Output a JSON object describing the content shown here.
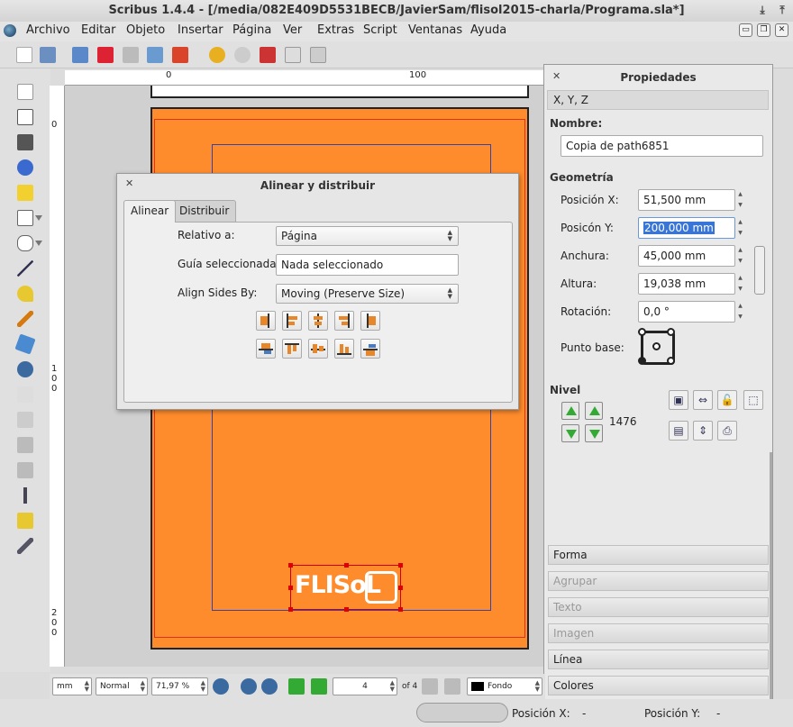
{
  "window": {
    "title": "Scribus 1.4.4 - [/media/082E409D5531BECB/JavierSam/flisol2015-charla/Programa.sla*]"
  },
  "menu": [
    "Archivo",
    "Editar",
    "Objeto",
    "Insertar",
    "Página",
    "Ver",
    "Extras",
    "Script",
    "Ventanas",
    "Ayuda"
  ],
  "ruler": {
    "top_0": "0",
    "top_100": "100",
    "left_0": "0",
    "left_100": [
      "1",
      "0",
      "0"
    ],
    "left_200": [
      "2",
      "0",
      "0"
    ]
  },
  "canvas": {
    "logo_text": "FLISoL"
  },
  "dialog": {
    "title": "Alinear y distribuir",
    "tabs": [
      "Alinear",
      "Distribuir"
    ],
    "relativo_label": "Relativo a:",
    "relativo_value": "Página",
    "guia_label": "Guía seleccionada:",
    "guia_value": "Nada seleccionado",
    "align_label": "Align Sides By:",
    "align_value": "Moving (Preserve Size)"
  },
  "props": {
    "title": "Propiedades",
    "xyz_tab": "X, Y, Z",
    "nombre_label": "Nombre:",
    "nombre_value": "Copia de   path6851",
    "geometria_label": "Geometría",
    "pos_x_label": "Posición X:",
    "pos_x_value": "51,500 mm",
    "pos_y_label": "Posicón Y:",
    "pos_y_value": "200,000 mm",
    "anchura_label": "Anchura:",
    "anchura_value": "45,000 mm",
    "altura_label": "Altura:",
    "altura_value": "19,038 mm",
    "rotacion_label": "Rotación:",
    "rotacion_value": "0,0 °",
    "punto_base_label": "Punto base:",
    "nivel_label": "Nivel",
    "nivel_value": "1476",
    "sections": [
      {
        "label": "Forma",
        "enabled": true
      },
      {
        "label": "Agrupar",
        "enabled": false
      },
      {
        "label": "Texto",
        "enabled": false
      },
      {
        "label": "Imagen",
        "enabled": false
      },
      {
        "label": "Línea",
        "enabled": true
      },
      {
        "label": "Colores",
        "enabled": true
      }
    ]
  },
  "status": {
    "unit": "mm",
    "quality": "Normal",
    "zoom": "71,97 %",
    "page": "4",
    "page_of": "of 4",
    "layer": "Fondo",
    "pos_x_label": "Posición X:",
    "pos_x_value": "-",
    "pos_y_label": "Posición Y:",
    "pos_y_value": "-"
  }
}
